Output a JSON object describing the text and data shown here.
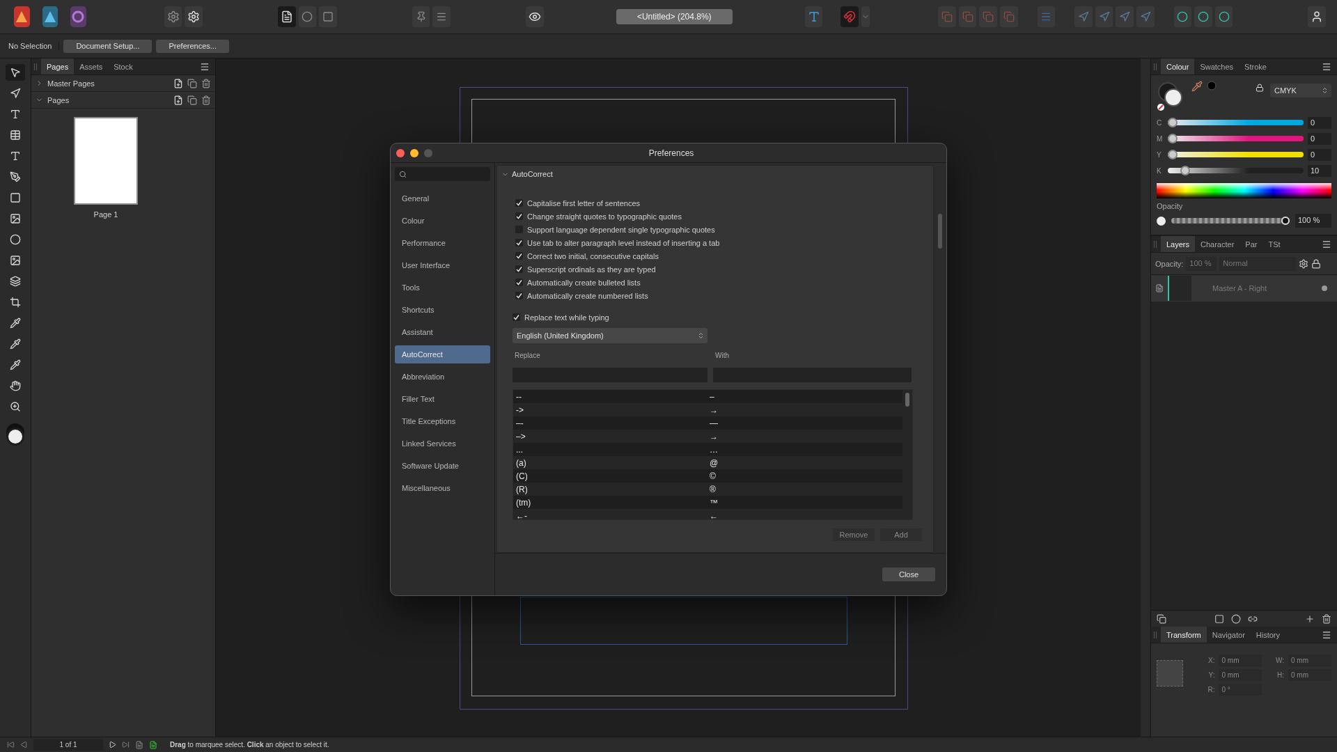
{
  "document_title": "<Untitled> (204.8%)",
  "context_bar": {
    "selection": "No Selection",
    "buttons": [
      "Document Setup...",
      "Preferences..."
    ]
  },
  "pages_panel": {
    "tabs": [
      {
        "label": "Pages",
        "selected": true
      },
      {
        "label": "Assets",
        "selected": false
      },
      {
        "label": "Stock",
        "selected": false
      }
    ],
    "sections": [
      {
        "label": "Master Pages",
        "expanded": false
      },
      {
        "label": "Pages",
        "expanded": true
      }
    ],
    "pages": [
      {
        "label": "Page 1"
      }
    ]
  },
  "dialog": {
    "title": "Preferences",
    "categories": [
      {
        "label": "General",
        "selected": false
      },
      {
        "label": "Colour",
        "selected": false
      },
      {
        "label": "Performance",
        "selected": false
      },
      {
        "label": "User Interface",
        "selected": false
      },
      {
        "label": "Tools",
        "selected": false
      },
      {
        "label": "Shortcuts",
        "selected": false
      },
      {
        "label": "Assistant",
        "selected": false
      },
      {
        "label": "AutoCorrect",
        "selected": true
      },
      {
        "label": "Abbreviation",
        "selected": false
      },
      {
        "label": "Filler Text",
        "selected": false
      },
      {
        "label": "Title Exceptions",
        "selected": false
      },
      {
        "label": "Linked Services",
        "selected": false
      },
      {
        "label": "Software Update",
        "selected": false
      },
      {
        "label": "Miscellaneous",
        "selected": false
      }
    ],
    "section": {
      "title": "AutoCorrect",
      "expanded": true
    },
    "options": [
      {
        "label": "Capitalise first letter of sentences",
        "checked": true
      },
      {
        "label": "Change straight quotes to typographic quotes",
        "checked": true
      },
      {
        "label": "Support language dependent single typographic quotes",
        "checked": false
      },
      {
        "label": "Use tab to alter paragraph level instead of inserting a tab",
        "checked": true
      },
      {
        "label": "Correct two initial, consecutive capitals",
        "checked": true
      },
      {
        "label": "Superscript ordinals as they are typed",
        "checked": true
      },
      {
        "label": "Automatically create bulleted lists",
        "checked": true
      },
      {
        "label": "Automatically create numbered lists",
        "checked": true
      }
    ],
    "replace_option": {
      "label": "Replace text while typing",
      "checked": true
    },
    "language": "English (United Kingdom)",
    "replace_label": "Replace",
    "with_label": "With",
    "entries": [
      {
        "replace": "--",
        "with": "–"
      },
      {
        "replace": "->",
        "with": "→"
      },
      {
        "replace": "–-",
        "with": "—"
      },
      {
        "replace": "–>",
        "with": "→"
      },
      {
        "replace": "...",
        "with": "…"
      },
      {
        "replace": "(a)",
        "with": "@"
      },
      {
        "replace": "(C)",
        "with": "©"
      },
      {
        "replace": "(R)",
        "with": "®"
      },
      {
        "replace": "(tm)",
        "with": "™"
      },
      {
        "replace": "←-",
        "with": "←"
      }
    ],
    "buttons": [
      "Remove",
      "Add"
    ],
    "close": "Close"
  },
  "colour_panel": {
    "tabs": [
      {
        "label": "Colour",
        "selected": true
      },
      {
        "label": "Swatches",
        "selected": false
      },
      {
        "label": "Stroke",
        "selected": false
      }
    ],
    "model": "CMYK",
    "channels": [
      {
        "name": "C",
        "color": "#00a8e0",
        "level": 0,
        "reading": "0"
      },
      {
        "name": "M",
        "color": "#e0157f",
        "level": 0,
        "reading": "0"
      },
      {
        "name": "Y",
        "color": "#f0e000",
        "level": 0,
        "reading": "0"
      },
      {
        "name": "K",
        "color": "#202020",
        "level": 0.1,
        "reading": "10"
      }
    ],
    "opacity_label": "Opacity",
    "opacity": {
      "level": 1,
      "reading": "100 %"
    }
  },
  "layers_panel": {
    "tabs": [
      {
        "label": "Layers",
        "selected": true
      },
      {
        "label": "Character",
        "selected": false
      },
      {
        "label": "Par",
        "selected": false
      },
      {
        "label": "TSt",
        "selected": false
      }
    ],
    "opacity_label": "Opacity:",
    "opacity": "100 %",
    "blend": "Normal",
    "layers": [
      {
        "name": "Master A - Right"
      }
    ]
  },
  "transform_panel": {
    "tabs": [
      {
        "label": "Transform",
        "selected": true
      },
      {
        "label": "Navigator",
        "selected": false
      },
      {
        "label": "History",
        "selected": false
      }
    ],
    "fields": [
      {
        "label": "X:",
        "value": "0 mm"
      },
      {
        "label": "W:",
        "value": "0 mm"
      },
      {
        "label": "Y:",
        "value": "0 mm"
      },
      {
        "label": "H:",
        "value": "0 mm"
      },
      {
        "label": "R:",
        "value": "0 °"
      }
    ]
  },
  "status_bar": {
    "page": "1 of 1",
    "hint": "**Drag** to marquee select. **Click** an object to select it."
  }
}
